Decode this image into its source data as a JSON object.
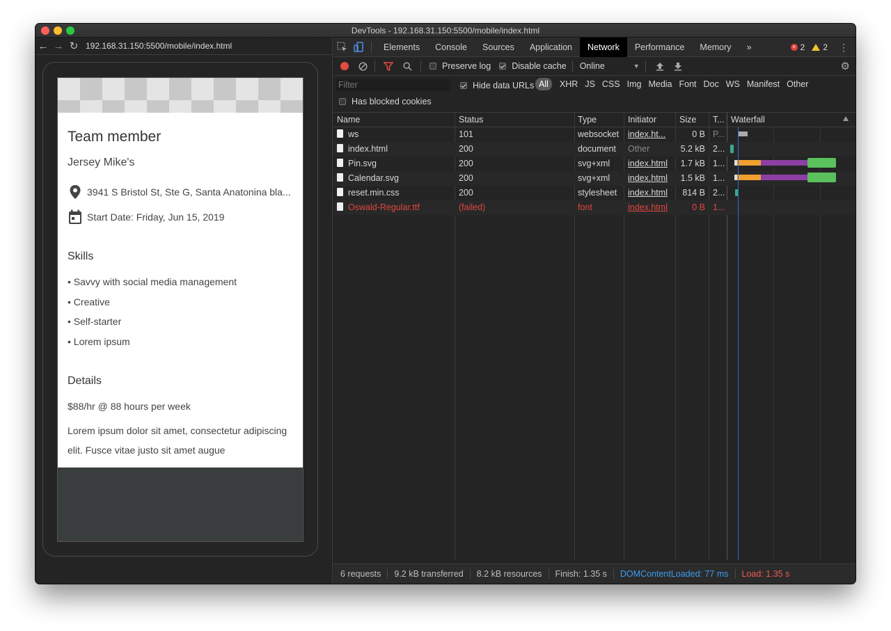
{
  "window": {
    "title": "DevTools - 192.168.31.150:5500/mobile/index.html"
  },
  "browser": {
    "url": "192.168.31.150:5500/mobile/index.html"
  },
  "card": {
    "title": "Team member",
    "company": "Jersey Mike's",
    "address": "3941 S Bristol St, Ste G, Santa Anatonina bla...",
    "start_date": "Start Date: Friday, Jun 15, 2019",
    "skills_heading": "Skills",
    "skills": [
      "• Savvy with social media management",
      "• Creative",
      "• Self-starter",
      "• Lorem ipsum"
    ],
    "details_heading": "Details",
    "rate": "$88/hr @ 88 hours per week",
    "description": "Lorem ipsum dolor sit amet, consectetur adipiscing elit. Fusce vitae justo sit amet augue"
  },
  "devtools": {
    "tabs": [
      "Elements",
      "Console",
      "Sources",
      "Application",
      "Network",
      "Performance",
      "Memory"
    ],
    "active_tab": "Network",
    "more_tabs": "»",
    "errors": "2",
    "warnings": "2",
    "toolbar": {
      "preserve_log": "Preserve log",
      "preserve_log_checked": false,
      "disable_cache": "Disable cache",
      "disable_cache_checked": true,
      "throttle": "Online"
    },
    "filter": {
      "placeholder": "Filter",
      "hide_data_urls": "Hide data URLs",
      "hide_data_urls_checked": true,
      "types": [
        "All",
        "XHR",
        "JS",
        "CSS",
        "Img",
        "Media",
        "Font",
        "Doc",
        "WS",
        "Manifest",
        "Other"
      ],
      "active_type": "All",
      "blocked_cookies": "Has blocked cookies",
      "blocked_cookies_checked": false
    },
    "columns": {
      "name": "Name",
      "status": "Status",
      "type": "Type",
      "initiator": "Initiator",
      "size": "Size",
      "time": "T...",
      "waterfall": "Waterfall"
    },
    "requests": [
      {
        "name": "ws",
        "status": "101",
        "type": "websocket",
        "initiator": "index.ht...",
        "size": "0 B",
        "time": "P...",
        "failed": false
      },
      {
        "name": "index.html",
        "status": "200",
        "type": "document",
        "initiator": "Other",
        "size": "5.2 kB",
        "time": "2...",
        "failed": false
      },
      {
        "name": "Pin.svg",
        "status": "200",
        "type": "svg+xml",
        "initiator": "index.html",
        "size": "1.7 kB",
        "time": "1...",
        "failed": false
      },
      {
        "name": "Calendar.svg",
        "status": "200",
        "type": "svg+xml",
        "initiator": "index.html",
        "size": "1.5 kB",
        "time": "1...",
        "failed": false
      },
      {
        "name": "reset.min.css",
        "status": "200",
        "type": "stylesheet",
        "initiator": "index.html",
        "size": "814 B",
        "time": "2...",
        "failed": false
      },
      {
        "name": "Oswald-Regular.ttf",
        "status": "(failed)",
        "type": "font",
        "initiator": "index.html",
        "size": "0 B",
        "time": "1...",
        "failed": true
      }
    ],
    "status_bar": {
      "requests": "6 requests",
      "transferred": "9.2 kB transferred",
      "resources": "8.2 kB resources",
      "finish": "Finish: 1.35 s",
      "dom_content_loaded": "DOMContentLoaded: 77 ms",
      "load": "Load: 1.35 s"
    }
  },
  "colors": {
    "dcl_blue": "#3d9bf0",
    "load_red": "#ef5a50",
    "failed_red": "#e0463e",
    "bar_waiting": "#f0a030",
    "bar_download": "#8e3fa5",
    "bar_receive": "#5ac15d",
    "record_red": "#e34b40"
  }
}
